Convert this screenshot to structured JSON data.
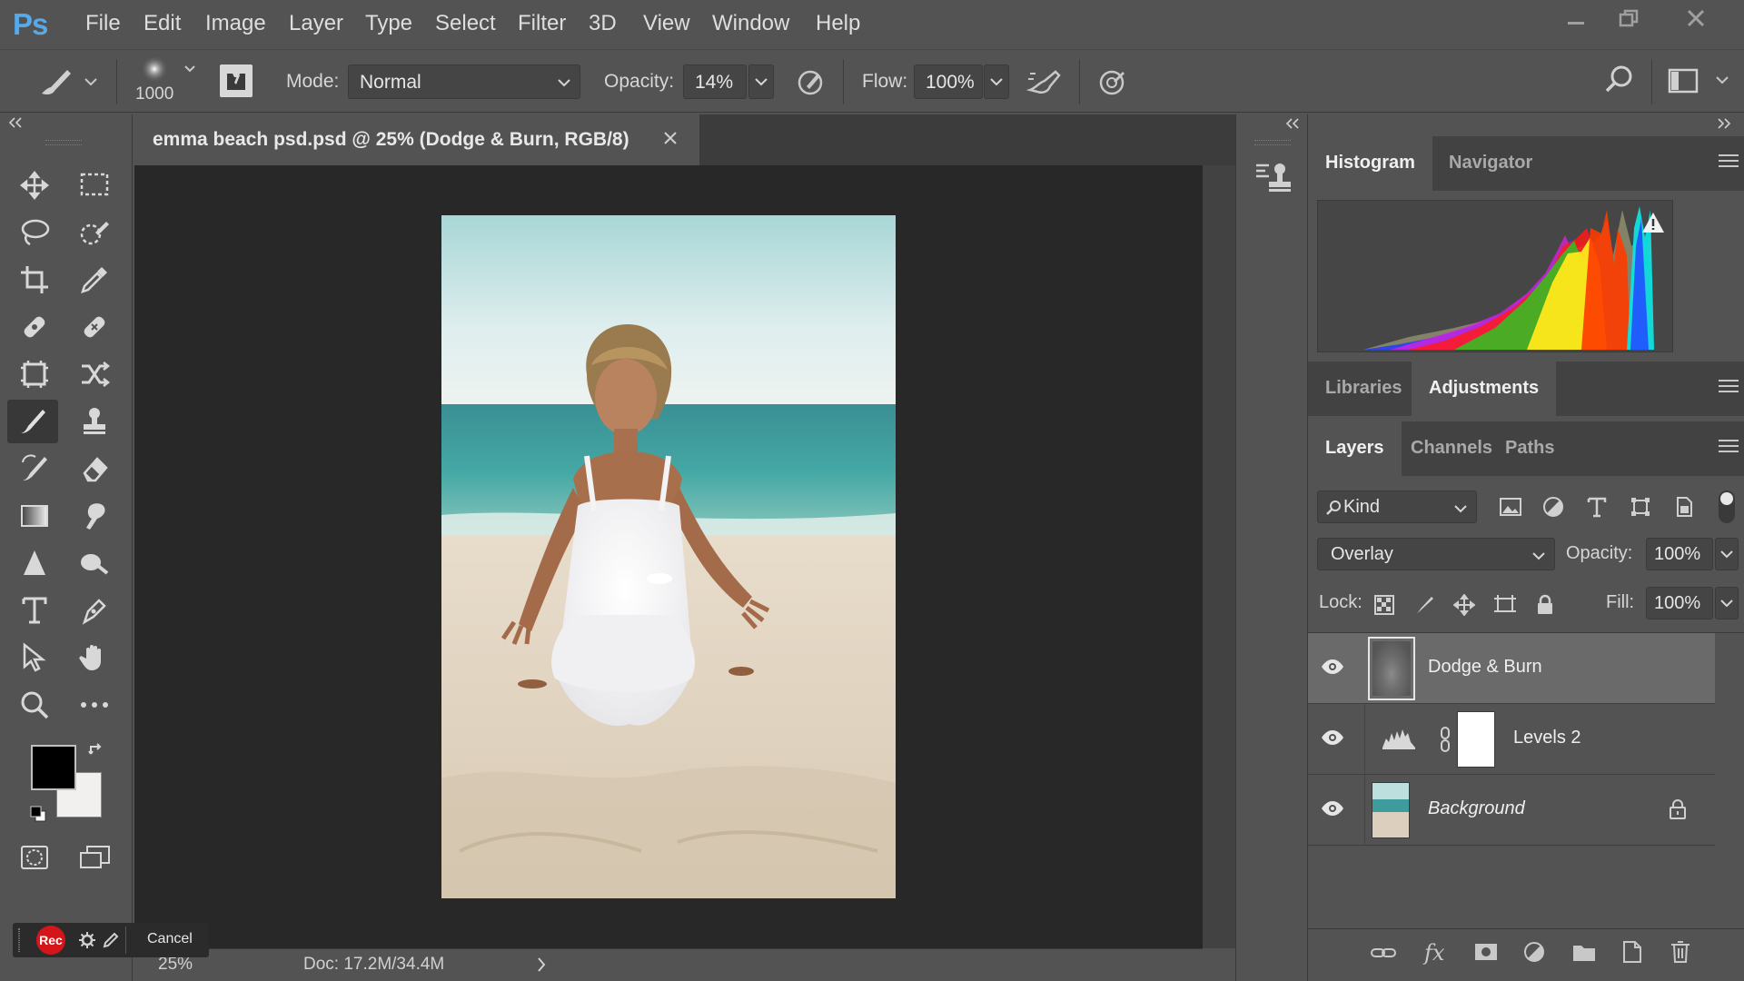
{
  "app": {
    "logo": "Ps",
    "accent": "#58a9e8"
  },
  "menu": [
    "File",
    "Edit",
    "Image",
    "Layer",
    "Type",
    "Select",
    "Filter",
    "3D",
    "View",
    "Window",
    "Help"
  ],
  "options": {
    "brush_size": "1000",
    "mode_label": "Mode:",
    "mode_value": "Normal",
    "opacity_label": "Opacity:",
    "opacity_value": "14%",
    "flow_label": "Flow:",
    "flow_value": "100%"
  },
  "document": {
    "tab_title": "emma beach psd.psd @ 25% (Dodge & Burn, RGB/8)",
    "zoom": "25%",
    "doc_info": "Doc: 17.2M/34.4M"
  },
  "toolbox": {
    "tools": [
      "move-tool",
      "marquee-tool",
      "lasso-tool",
      "quick-select-tool",
      "crop-tool",
      "eyedropper-tool",
      "spot-heal-tool",
      "healing-brush-tool",
      "content-aware-move-tool",
      "patch-tool",
      "brush-tool",
      "clone-stamp-tool",
      "history-brush-tool",
      "eraser-tool",
      "gradient-tool",
      "smudge-tool",
      "sharpen-tool",
      "dodge-tool",
      "type-tool",
      "pen-tool",
      "path-select-tool",
      "hand-tool",
      "zoom-tool",
      "more-tools"
    ],
    "foreground_color": "#000000",
    "background_color": "#f2f0ee"
  },
  "panels": {
    "top_tabs": [
      "Histogram",
      "Navigator"
    ],
    "mid_tabs": [
      "Libraries",
      "Adjustments"
    ],
    "layer_tabs": [
      "Layers",
      "Channels",
      "Paths"
    ],
    "filter_kind": "Kind",
    "blend_mode": "Overlay",
    "opacity_label": "Opacity:",
    "opacity_value": "100%",
    "lock_label": "Lock:",
    "fill_label": "Fill:",
    "fill_value": "100%",
    "layers": [
      {
        "name": "Dodge & Burn",
        "selected": true
      },
      {
        "name": "Levels 2",
        "selected": false
      },
      {
        "name": "Background",
        "selected": false,
        "locked": true
      }
    ]
  },
  "recorder": {
    "rec": "Rec",
    "cancel": "Cancel"
  }
}
